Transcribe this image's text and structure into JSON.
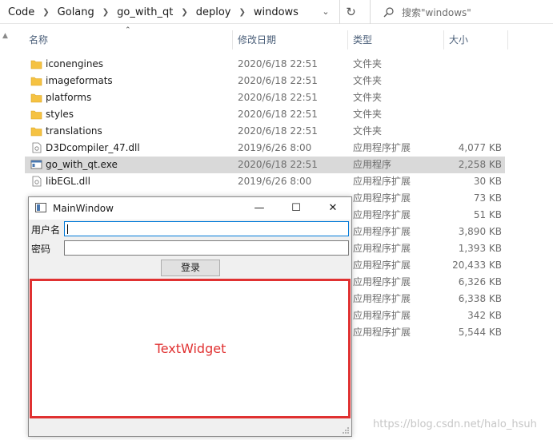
{
  "breadcrumbs": [
    "Code",
    "Golang",
    "go_with_qt",
    "deploy",
    "windows"
  ],
  "search": {
    "placeholder": "搜索\"windows\""
  },
  "columns": {
    "name": "名称",
    "date": "修改日期",
    "type": "类型",
    "size": "大小"
  },
  "files": [
    {
      "name": "iconengines",
      "date": "2020/6/18 22:51",
      "type": "文件夹",
      "size": "",
      "icon": "folder-icon"
    },
    {
      "name": "imageformats",
      "date": "2020/6/18 22:51",
      "type": "文件夹",
      "size": "",
      "icon": "folder-icon"
    },
    {
      "name": "platforms",
      "date": "2020/6/18 22:51",
      "type": "文件夹",
      "size": "",
      "icon": "folder-icon"
    },
    {
      "name": "styles",
      "date": "2020/6/18 22:51",
      "type": "文件夹",
      "size": "",
      "icon": "folder-icon"
    },
    {
      "name": "translations",
      "date": "2020/6/18 22:51",
      "type": "文件夹",
      "size": "",
      "icon": "folder-icon"
    },
    {
      "name": "D3Dcompiler_47.dll",
      "date": "2019/6/26 8:00",
      "type": "应用程序扩展",
      "size": "4,077 KB",
      "icon": "dll-file-icon"
    },
    {
      "name": "go_with_qt.exe",
      "date": "2020/6/18 22:51",
      "type": "应用程序",
      "size": "2,258 KB",
      "icon": "exe-file-icon"
    },
    {
      "name": "libEGL.dll",
      "date": "2019/6/26 8:00",
      "type": "应用程序扩展",
      "size": "30 KB",
      "icon": "dll-file-icon"
    },
    {
      "name": "",
      "date": "",
      "type": "应用程序扩展",
      "size": "73 KB",
      "icon": ""
    },
    {
      "name": "",
      "date": "",
      "type": "应用程序扩展",
      "size": "51 KB",
      "icon": ""
    },
    {
      "name": "",
      "date": "",
      "type": "应用程序扩展",
      "size": "3,890 KB",
      "icon": ""
    },
    {
      "name": "",
      "date": "",
      "type": "应用程序扩展",
      "size": "1,393 KB",
      "icon": ""
    },
    {
      "name": "",
      "date": "",
      "type": "应用程序扩展",
      "size": "20,433 KB",
      "icon": ""
    },
    {
      "name": "",
      "date": "",
      "type": "应用程序扩展",
      "size": "6,326 KB",
      "icon": ""
    },
    {
      "name": "",
      "date": "",
      "type": "应用程序扩展",
      "size": "6,338 KB",
      "icon": ""
    },
    {
      "name": "",
      "date": "",
      "type": "应用程序扩展",
      "size": "342 KB",
      "icon": ""
    },
    {
      "name": "",
      "date": "",
      "type": "应用程序扩展",
      "size": "5,544 KB",
      "icon": ""
    }
  ],
  "selected_file": "go_with_qt.exe",
  "qt_window": {
    "title": "MainWindow",
    "username_label": "用户名",
    "username_value": "",
    "password_label": "密码",
    "password_value": "",
    "login_button": "登录",
    "text_widget_label": "TextWidget"
  },
  "watermark": "https://blog.csdn.net/halo_hsuh",
  "colors": {
    "highlight": "#e03131",
    "selection": "#d9d9d9",
    "focus": "#0078d7",
    "folder": "#f5c242"
  }
}
